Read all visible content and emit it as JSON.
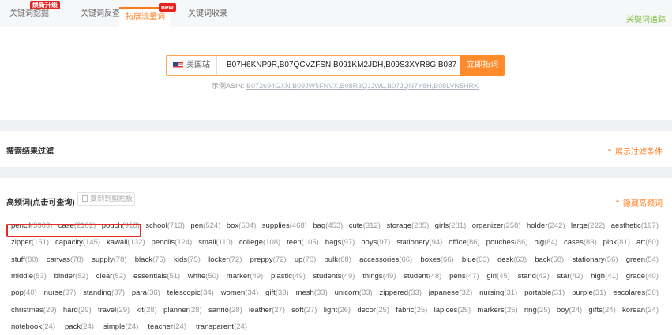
{
  "tabs": [
    {
      "label": "关键词挖掘",
      "badge": "焕新升级"
    },
    {
      "label": "关键词反查",
      "badge": ""
    },
    {
      "label": "拓展流量词",
      "badge": "new",
      "active": true
    },
    {
      "label": "关键词收录",
      "badge": ""
    }
  ],
  "tab_right_label": "关键词追踪",
  "search": {
    "site": "美国站",
    "value": "B07H6KNP9R,B07QCVZFSN,B091KM2JDH,B09S3XYR8G,B087CXBC",
    "button": "立即拓词",
    "example_label": "示例ASIN:",
    "example_value": "B072694GXN,B09JW5FNVX,B08R3QJJWL,B07JQN7Y8H,B08LVN5HRK"
  },
  "filter": {
    "title": "搜索结果过滤",
    "toggle": "展示过滤条件"
  },
  "high_freq": {
    "title": "高频词(点击可查询)",
    "copy_button": "复制到剪贴板",
    "toggle": "隐藏高频词",
    "rows": [
      [
        [
          "pencil",
          "3363"
        ],
        [
          "case",
          "2162"
        ],
        [
          "pouch",
          "916"
        ],
        [
          "school",
          "713"
        ],
        [
          "pen",
          "524"
        ],
        [
          "box",
          "504"
        ],
        [
          "supplies",
          "468"
        ],
        [
          "bag",
          "453"
        ],
        [
          "cute",
          "312"
        ],
        [
          "storage",
          "285"
        ],
        [
          "girls",
          "281"
        ],
        [
          "organizer",
          "258"
        ],
        [
          "holder",
          "242"
        ],
        [
          "large",
          "222"
        ],
        [
          "aesthetic",
          "197"
        ]
      ],
      [
        [
          "zipper",
          "151"
        ],
        [
          "capacity",
          "145"
        ],
        [
          "kawaii",
          "132"
        ],
        [
          "pencils",
          "124"
        ],
        [
          "small",
          "110"
        ],
        [
          "college",
          "108"
        ],
        [
          "teen",
          "105"
        ],
        [
          "bags",
          "97"
        ],
        [
          "boys",
          "97"
        ],
        [
          "stationery",
          "94"
        ],
        [
          "office",
          "86"
        ],
        [
          "pouches",
          "86"
        ],
        [
          "big",
          "84"
        ],
        [
          "cases",
          "83"
        ],
        [
          "pink",
          "81"
        ],
        [
          "art",
          "80"
        ]
      ],
      [
        [
          "stuff",
          "80"
        ],
        [
          "canvas",
          "78"
        ],
        [
          "supply",
          "78"
        ],
        [
          "black",
          "75"
        ],
        [
          "kids",
          "75"
        ],
        [
          "locker",
          "72"
        ],
        [
          "preppy",
          "72"
        ],
        [
          "up",
          "70"
        ],
        [
          "bulk",
          "68"
        ],
        [
          "accessories",
          "66"
        ],
        [
          "boxes",
          "66"
        ],
        [
          "blue",
          "63"
        ],
        [
          "desk",
          "63"
        ],
        [
          "back",
          "58"
        ],
        [
          "stationary",
          "56"
        ],
        [
          "green",
          "54"
        ]
      ],
      [
        [
          "middle",
          "53"
        ],
        [
          "binder",
          "52"
        ],
        [
          "clear",
          "52"
        ],
        [
          "essentials",
          "51"
        ],
        [
          "white",
          "50"
        ],
        [
          "marker",
          "49"
        ],
        [
          "plastic",
          "49"
        ],
        [
          "students",
          "49"
        ],
        [
          "things",
          "49"
        ],
        [
          "student",
          "48"
        ],
        [
          "pens",
          "47"
        ],
        [
          "girl",
          "45"
        ],
        [
          "stand",
          "42"
        ],
        [
          "star",
          "42"
        ],
        [
          "high",
          "41"
        ],
        [
          "grade",
          "40"
        ]
      ],
      [
        [
          "pop",
          "40"
        ],
        [
          "nurse",
          "37"
        ],
        [
          "standing",
          "37"
        ],
        [
          "para",
          "36"
        ],
        [
          "telescopic",
          "34"
        ],
        [
          "women",
          "34"
        ],
        [
          "gift",
          "33"
        ],
        [
          "mesh",
          "33"
        ],
        [
          "unicorn",
          "33"
        ],
        [
          "zippered",
          "33"
        ],
        [
          "japanese",
          "32"
        ],
        [
          "nursing",
          "31"
        ],
        [
          "portable",
          "31"
        ],
        [
          "purple",
          "31"
        ],
        [
          "escolares",
          "30"
        ]
      ],
      [
        [
          "christmas",
          "29"
        ],
        [
          "hard",
          "29"
        ],
        [
          "travel",
          "29"
        ],
        [
          "kit",
          "28"
        ],
        [
          "planner",
          "28"
        ],
        [
          "sanrio",
          "28"
        ],
        [
          "leather",
          "27"
        ],
        [
          "soft",
          "27"
        ],
        [
          "light",
          "26"
        ],
        [
          "decor",
          "25"
        ],
        [
          "fabric",
          "25"
        ],
        [
          "lapices",
          "25"
        ],
        [
          "markers",
          "25"
        ],
        [
          "ring",
          "25"
        ],
        [
          "boy",
          "24"
        ],
        [
          "gifts",
          "24"
        ],
        [
          "korean",
          "24"
        ]
      ],
      [
        [
          "notebook",
          "24"
        ],
        [
          "pack",
          "24"
        ],
        [
          "simple",
          "24"
        ],
        [
          "teacher",
          "24"
        ],
        [
          "transparent",
          "24"
        ]
      ]
    ]
  }
}
